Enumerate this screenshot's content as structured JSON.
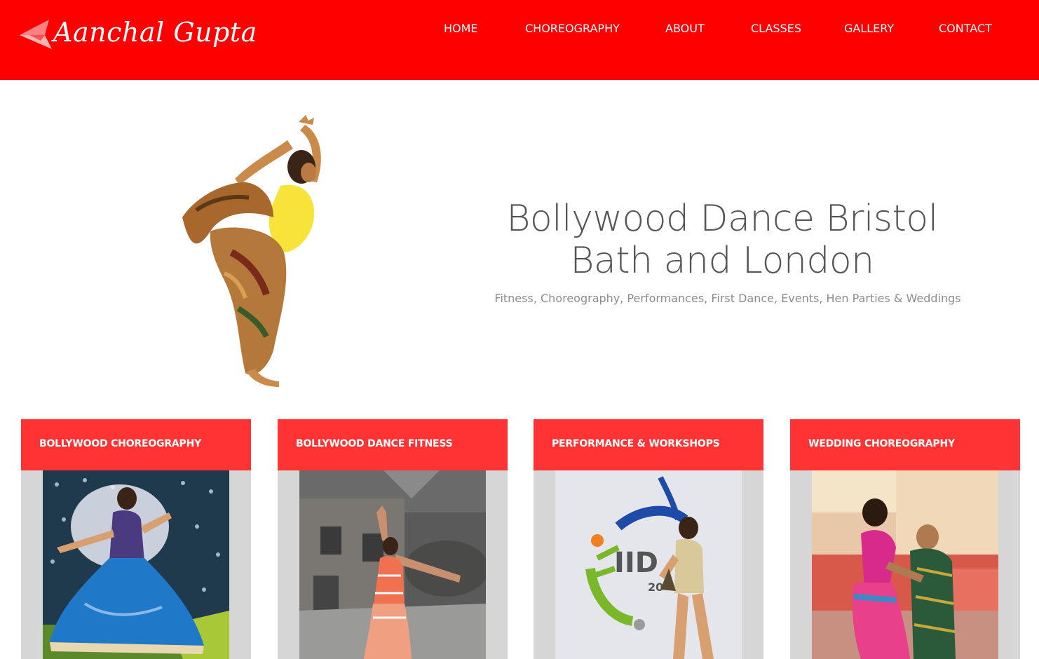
{
  "brand": {
    "name": "Aanchal Gupta",
    "color": "#ff0000"
  },
  "nav": {
    "items": [
      {
        "label": "HOME"
      },
      {
        "label": "CHOREOGRAPHY"
      },
      {
        "label": "ABOUT"
      },
      {
        "label": "CLASSES"
      },
      {
        "label": "GALLERY"
      },
      {
        "label": "CONTACT"
      }
    ]
  },
  "hero": {
    "title_line1": "Bollywood Dance Bristol",
    "title_line2": "Bath and London",
    "subtitle": "Fitness, Choreography, Performances, First Dance, Events, Hen Parties & Weddings",
    "image_icon": "dancer-photo"
  },
  "cards": [
    {
      "title": "BOLLYWOOD CHOREOGRAPHY",
      "image_icon": "stage-dancer-photo"
    },
    {
      "title": "BOLLYWOOD DANCE FITNESS",
      "image_icon": "street-dancer-photo"
    },
    {
      "title": "PERFORMANCE & WORKSHOPS",
      "image_icon": "award-dancer-photo"
    },
    {
      "title": "WEDDING CHOREOGRAPHY",
      "image_icon": "wedding-couple-photo"
    }
  ],
  "colors": {
    "header_bg": "#ff0000",
    "card_head_bg": "#ff3333",
    "card_body_bg": "#d6d6d6",
    "title_text": "#555555",
    "subtitle_text": "#8c8c8c"
  }
}
